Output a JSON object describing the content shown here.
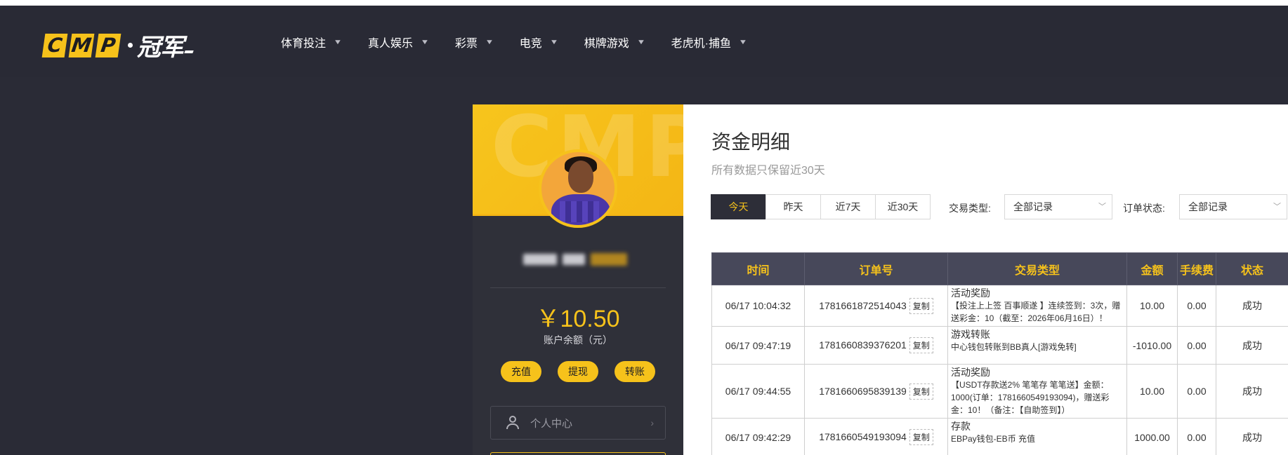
{
  "header": {
    "logo": {
      "letters": [
        "C",
        "M",
        "P"
      ],
      "text": "冠军"
    },
    "nav": [
      {
        "label": "体育投注"
      },
      {
        "label": "真人娱乐"
      },
      {
        "label": "彩票"
      },
      {
        "label": "电竞"
      },
      {
        "label": "棋牌游戏"
      },
      {
        "label": "老虎机·捕鱼"
      }
    ],
    "chevron_glyph": "▼"
  },
  "user": {
    "banner_watermark": "CMP",
    "balance": "￥10.50",
    "balance_label": "账户余额（元）",
    "actions": [
      "充值",
      "提现",
      "转账"
    ],
    "menu": {
      "label": "个人中心",
      "arrow": "›"
    }
  },
  "main": {
    "title": "资金明细",
    "subtitle": "所有数据只保留近30天",
    "tabs": [
      "今天",
      "昨天",
      "近7天",
      "近30天"
    ],
    "active_tab": "今天",
    "filters": {
      "type_label": "交易类型:",
      "type_value": "全部记录",
      "status_label": "订单状态:",
      "status_value": "全部记录"
    },
    "table": {
      "headers": [
        "时间",
        "订单号",
        "交易类型",
        "金额",
        "手续费",
        "状态"
      ],
      "copy_label": "复制",
      "rows": [
        {
          "time": "06/17 10:04:32",
          "order": "1781661872514043",
          "type_title": "活动奖励",
          "type_desc": "【投注上上签 百事顺遂 】连续签到：3次，赠送彩金：10（截至：2026年06月16日）！",
          "amount": "10.00",
          "fee": "0.00",
          "status": "成功"
        },
        {
          "time": "06/17 09:47:19",
          "order": "1781660839376201",
          "type_title": "游戏转账",
          "type_desc": "中心钱包转账到BB真人[游戏免转]",
          "amount": "-1010.00",
          "fee": "0.00",
          "status": "成功"
        },
        {
          "time": "06/17 09:44:55",
          "order": "1781660695839139",
          "type_title": "活动奖励",
          "type_desc": "【USDT存款送2% 笔笔存 笔笔送】金额：1000(订单：1781660549193094)，赠送彩金：10！（备注：【自助签到】）",
          "amount": "10.00",
          "fee": "0.00",
          "status": "成功"
        },
        {
          "time": "06/17 09:42:29",
          "order": "1781660549193094",
          "type_title": "存款",
          "type_desc": "EBPay钱包-EB币 充值",
          "amount": "1000.00",
          "fee": "0.00",
          "status": "成功"
        }
      ]
    }
  },
  "colors": {
    "accent": "#f6c21b",
    "header_bg": "#292a35",
    "table_header_bg": "#47485a",
    "success": "#2a9a2a"
  }
}
